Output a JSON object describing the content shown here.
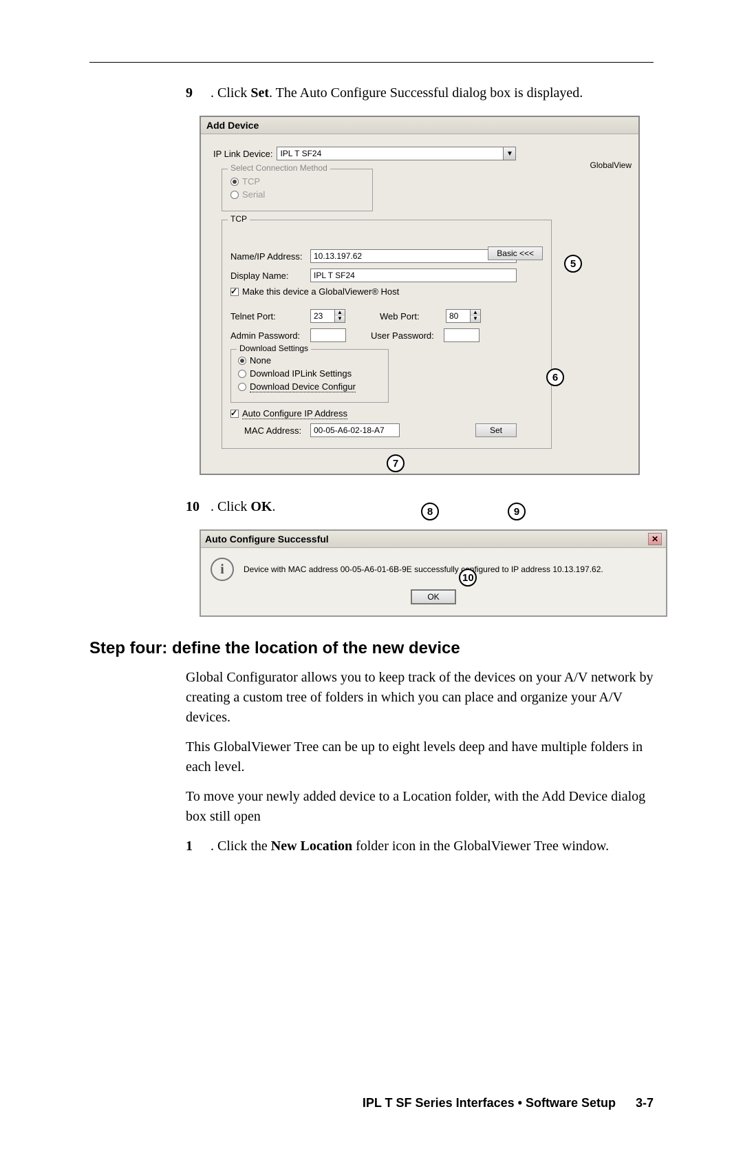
{
  "step9": {
    "num": "9",
    "text_before": ". Click ",
    "bold": "Set",
    "text_after": ". The Auto Configure Successful dialog box is displayed."
  },
  "addDevice": {
    "title": "Add Device",
    "ipLinkLabel": "IP Link Device:",
    "ipLinkValue": "IPL T SF24",
    "globalview": "GlobalView",
    "connMethod": {
      "legend": "Select Connection Method",
      "tcp": "TCP",
      "serial": "Serial"
    },
    "tcp": {
      "legend": "TCP",
      "basicBtn": "Basic <<<",
      "nameIpLabel": "Name/IP Address:",
      "nameIpValue": "10.13.197.62",
      "displayNameLabel": "Display Name:",
      "displayNameValue": "IPL T SF24",
      "gvHost": "Make this device a GlobalViewer® Host",
      "telnetLabel": "Telnet Port:",
      "telnetValue": "23",
      "webLabel": "Web Port:",
      "webValue": "80",
      "adminPwLabel": "Admin Password:",
      "userPwLabel": "User Password:",
      "download": {
        "legend": "Download Settings",
        "none": "None",
        "iplink": "Download IPLink Settings",
        "devconf": "Download Device Configur"
      },
      "autoConfig": "Auto Configure IP Address",
      "macLabel": "MAC Address:",
      "macValue": "00-05-A6-02-18-A7",
      "setBtn": "Set"
    }
  },
  "callouts": {
    "c5": "5",
    "c6": "6",
    "c7": "7",
    "c8": "8",
    "c9": "9",
    "c10": "10"
  },
  "step10": {
    "num": "10",
    "text": ". Click ",
    "bold": "OK",
    "after": "."
  },
  "autoDlg": {
    "title": "Auto Configure Successful",
    "msg": "Device with MAC address 00-05-A6-01-6B-9E successfully configured to IP address 10.13.197.62.",
    "ok": "OK"
  },
  "heading": "Step four: define the location of the new device",
  "p1": "Global Configurator allows you to keep track of the devices on your A/V network by creating a custom tree of folders in which you can place and organize your A/V devices.",
  "p2": "This GlobalViewer Tree can be up to eight levels deep and have multiple folders in each level.",
  "p3": "To move your newly added device to a Location folder, with the Add Device dialog box still open",
  "step1b": {
    "num": "1",
    "text_before": ". Click the ",
    "bold": "New Location",
    "text_after": " folder icon in the GlobalViewer Tree window."
  },
  "footer": {
    "text": "IPL T SF Series Interfaces • Software Setup",
    "page": "3-7"
  }
}
